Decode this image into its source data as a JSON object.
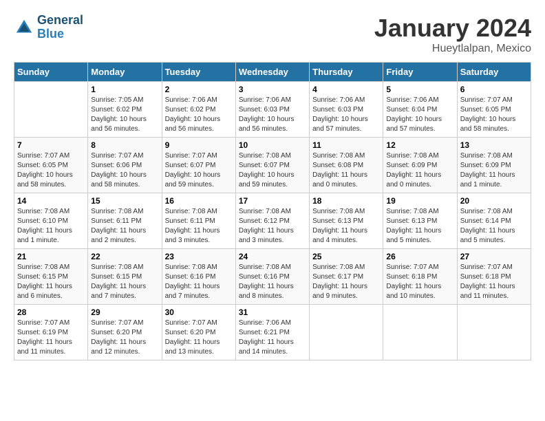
{
  "header": {
    "logo_line1": "General",
    "logo_line2": "Blue",
    "title": "January 2024",
    "subtitle": "Hueytlalpan, Mexico"
  },
  "weekdays": [
    "Sunday",
    "Monday",
    "Tuesday",
    "Wednesday",
    "Thursday",
    "Friday",
    "Saturday"
  ],
  "weeks": [
    [
      {
        "day": "",
        "info": ""
      },
      {
        "day": "1",
        "info": "Sunrise: 7:05 AM\nSunset: 6:02 PM\nDaylight: 10 hours\nand 56 minutes."
      },
      {
        "day": "2",
        "info": "Sunrise: 7:06 AM\nSunset: 6:02 PM\nDaylight: 10 hours\nand 56 minutes."
      },
      {
        "day": "3",
        "info": "Sunrise: 7:06 AM\nSunset: 6:03 PM\nDaylight: 10 hours\nand 56 minutes."
      },
      {
        "day": "4",
        "info": "Sunrise: 7:06 AM\nSunset: 6:03 PM\nDaylight: 10 hours\nand 57 minutes."
      },
      {
        "day": "5",
        "info": "Sunrise: 7:06 AM\nSunset: 6:04 PM\nDaylight: 10 hours\nand 57 minutes."
      },
      {
        "day": "6",
        "info": "Sunrise: 7:07 AM\nSunset: 6:05 PM\nDaylight: 10 hours\nand 58 minutes."
      }
    ],
    [
      {
        "day": "7",
        "info": "Sunrise: 7:07 AM\nSunset: 6:05 PM\nDaylight: 10 hours\nand 58 minutes."
      },
      {
        "day": "8",
        "info": "Sunrise: 7:07 AM\nSunset: 6:06 PM\nDaylight: 10 hours\nand 58 minutes."
      },
      {
        "day": "9",
        "info": "Sunrise: 7:07 AM\nSunset: 6:07 PM\nDaylight: 10 hours\nand 59 minutes."
      },
      {
        "day": "10",
        "info": "Sunrise: 7:08 AM\nSunset: 6:07 PM\nDaylight: 10 hours\nand 59 minutes."
      },
      {
        "day": "11",
        "info": "Sunrise: 7:08 AM\nSunset: 6:08 PM\nDaylight: 11 hours\nand 0 minutes."
      },
      {
        "day": "12",
        "info": "Sunrise: 7:08 AM\nSunset: 6:09 PM\nDaylight: 11 hours\nand 0 minutes."
      },
      {
        "day": "13",
        "info": "Sunrise: 7:08 AM\nSunset: 6:09 PM\nDaylight: 11 hours\nand 1 minute."
      }
    ],
    [
      {
        "day": "14",
        "info": "Sunrise: 7:08 AM\nSunset: 6:10 PM\nDaylight: 11 hours\nand 1 minute."
      },
      {
        "day": "15",
        "info": "Sunrise: 7:08 AM\nSunset: 6:11 PM\nDaylight: 11 hours\nand 2 minutes."
      },
      {
        "day": "16",
        "info": "Sunrise: 7:08 AM\nSunset: 6:11 PM\nDaylight: 11 hours\nand 3 minutes."
      },
      {
        "day": "17",
        "info": "Sunrise: 7:08 AM\nSunset: 6:12 PM\nDaylight: 11 hours\nand 3 minutes."
      },
      {
        "day": "18",
        "info": "Sunrise: 7:08 AM\nSunset: 6:13 PM\nDaylight: 11 hours\nand 4 minutes."
      },
      {
        "day": "19",
        "info": "Sunrise: 7:08 AM\nSunset: 6:13 PM\nDaylight: 11 hours\nand 5 minutes."
      },
      {
        "day": "20",
        "info": "Sunrise: 7:08 AM\nSunset: 6:14 PM\nDaylight: 11 hours\nand 5 minutes."
      }
    ],
    [
      {
        "day": "21",
        "info": "Sunrise: 7:08 AM\nSunset: 6:15 PM\nDaylight: 11 hours\nand 6 minutes."
      },
      {
        "day": "22",
        "info": "Sunrise: 7:08 AM\nSunset: 6:15 PM\nDaylight: 11 hours\nand 7 minutes."
      },
      {
        "day": "23",
        "info": "Sunrise: 7:08 AM\nSunset: 6:16 PM\nDaylight: 11 hours\nand 7 minutes."
      },
      {
        "day": "24",
        "info": "Sunrise: 7:08 AM\nSunset: 6:16 PM\nDaylight: 11 hours\nand 8 minutes."
      },
      {
        "day": "25",
        "info": "Sunrise: 7:08 AM\nSunset: 6:17 PM\nDaylight: 11 hours\nand 9 minutes."
      },
      {
        "day": "26",
        "info": "Sunrise: 7:07 AM\nSunset: 6:18 PM\nDaylight: 11 hours\nand 10 minutes."
      },
      {
        "day": "27",
        "info": "Sunrise: 7:07 AM\nSunset: 6:18 PM\nDaylight: 11 hours\nand 11 minutes."
      }
    ],
    [
      {
        "day": "28",
        "info": "Sunrise: 7:07 AM\nSunset: 6:19 PM\nDaylight: 11 hours\nand 11 minutes."
      },
      {
        "day": "29",
        "info": "Sunrise: 7:07 AM\nSunset: 6:20 PM\nDaylight: 11 hours\nand 12 minutes."
      },
      {
        "day": "30",
        "info": "Sunrise: 7:07 AM\nSunset: 6:20 PM\nDaylight: 11 hours\nand 13 minutes."
      },
      {
        "day": "31",
        "info": "Sunrise: 7:06 AM\nSunset: 6:21 PM\nDaylight: 11 hours\nand 14 minutes."
      },
      {
        "day": "",
        "info": ""
      },
      {
        "day": "",
        "info": ""
      },
      {
        "day": "",
        "info": ""
      }
    ]
  ]
}
